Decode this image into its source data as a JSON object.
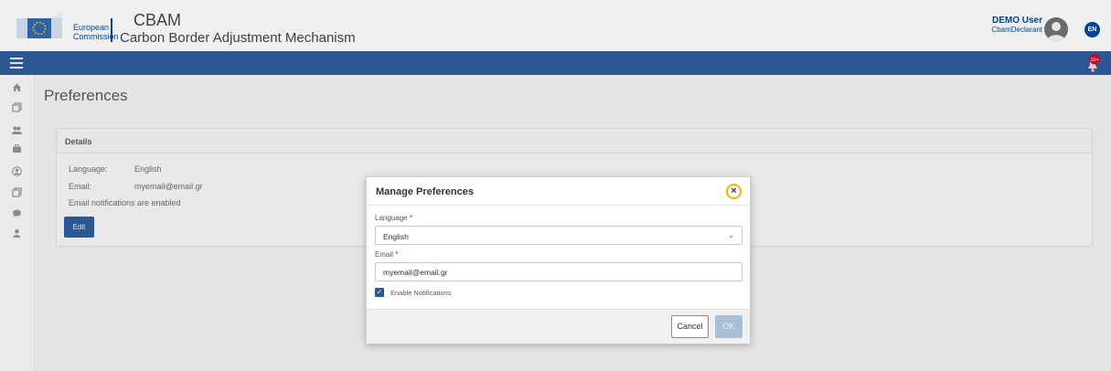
{
  "header": {
    "org_line1": "European",
    "org_line2": "Commission",
    "app_title": "CBAM",
    "app_subtitle": "Carbon Border Adjustment Mechanism",
    "user_name": "DEMO User",
    "user_role": "CbamDeclarant",
    "language_code": "EN"
  },
  "navbar": {
    "notification_badge": "10+"
  },
  "sidebar": {
    "icons": [
      "home-icon",
      "copy-icon",
      "users-icon",
      "briefcase-icon",
      "user-circle-icon",
      "copy-icon",
      "comment-icon",
      "user-icon"
    ]
  },
  "page": {
    "title": "Preferences"
  },
  "details": {
    "title": "Details",
    "language_label": "Language:",
    "language_value": "English",
    "email_label": "Email:",
    "email_value": "myemail@email.gr",
    "notifications_text": "Email notifications are enabled",
    "edit_label": "Edit"
  },
  "modal": {
    "title": "Manage Preferences",
    "language_label": "Language",
    "language_value": "English",
    "email_label": "Email",
    "email_value": "myemail@email.gr",
    "required_mark": "*",
    "notifications_label": "Enable Notifications",
    "notifications_checked": true,
    "cancel_label": "Cancel",
    "ok_label": "OK"
  },
  "colors": {
    "brand_blue": "#2b5894",
    "ec_blue": "#004494",
    "close_ring": "#f2b400"
  }
}
